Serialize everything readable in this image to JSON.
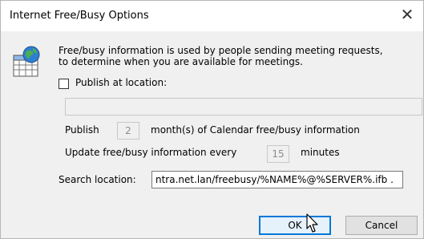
{
  "window": {
    "title": "Internet Free/Busy Options",
    "close_glyph": "✕"
  },
  "info": {
    "icon": "calendar-globe-icon",
    "line1": "Free/busy information is used by people sending meeting requests,",
    "line2": "to determine when you are available for meetings."
  },
  "publish_location": {
    "checkbox_label": "Publish at location:",
    "checked": false,
    "url_value": ""
  },
  "publish_months": {
    "label_before": "Publish",
    "value": "2",
    "label_after": "month(s) of Calendar free/busy information"
  },
  "update_interval": {
    "label_before": "Update free/busy information every",
    "value": "15",
    "label_after": "minutes"
  },
  "search_location": {
    "label": "Search location:",
    "value": "ntra.net.lan/freebusy/%NAME%@%SERVER%.ifb ."
  },
  "buttons": {
    "ok": "OK",
    "cancel": "Cancel"
  }
}
